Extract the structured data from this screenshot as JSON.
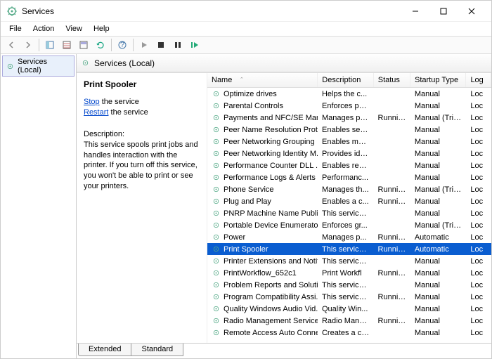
{
  "window": {
    "title": "Services"
  },
  "menu": [
    "File",
    "Action",
    "View",
    "Help"
  ],
  "left": {
    "item": "Services (Local)"
  },
  "listHeader": "Services (Local)",
  "details": {
    "selected": "Print Spooler",
    "stop": "Stop",
    "stop_suffix": " the service",
    "restart": "Restart",
    "restart_suffix": " the service",
    "desc_label": "Description:",
    "desc": "This service spools print jobs and handles interaction with the printer. If you turn off this service, you won't be able to print or see your printers."
  },
  "cols": {
    "name": "Name",
    "desc": "Description",
    "status": "Status",
    "startup": "Startup Type",
    "logon": "Log"
  },
  "rows": [
    {
      "name": "Optimize drives",
      "desc": "Helps the c...",
      "status": "",
      "startup": "Manual",
      "logon": "Loc"
    },
    {
      "name": "Parental Controls",
      "desc": "Enforces pa...",
      "status": "",
      "startup": "Manual",
      "logon": "Loc"
    },
    {
      "name": "Payments and NFC/SE Man...",
      "desc": "Manages pa...",
      "status": "Running",
      "startup": "Manual (Trig...",
      "logon": "Loc"
    },
    {
      "name": "Peer Name Resolution Prot...",
      "desc": "Enables serv...",
      "status": "",
      "startup": "Manual",
      "logon": "Loc"
    },
    {
      "name": "Peer Networking Grouping",
      "desc": "Enables mul...",
      "status": "",
      "startup": "Manual",
      "logon": "Loc"
    },
    {
      "name": "Peer Networking Identity M...",
      "desc": "Provides ide...",
      "status": "",
      "startup": "Manual",
      "logon": "Loc"
    },
    {
      "name": "Performance Counter DLL ...",
      "desc": "Enables rem...",
      "status": "",
      "startup": "Manual",
      "logon": "Loc"
    },
    {
      "name": "Performance Logs & Alerts",
      "desc": "Performanc...",
      "status": "",
      "startup": "Manual",
      "logon": "Loc"
    },
    {
      "name": "Phone Service",
      "desc": "Manages th...",
      "status": "Running",
      "startup": "Manual (Trig...",
      "logon": "Loc"
    },
    {
      "name": "Plug and Play",
      "desc": "Enables a c...",
      "status": "Running",
      "startup": "Manual",
      "logon": "Loc"
    },
    {
      "name": "PNRP Machine Name Publi...",
      "desc": "This service ...",
      "status": "",
      "startup": "Manual",
      "logon": "Loc"
    },
    {
      "name": "Portable Device Enumerator...",
      "desc": "Enforces gr...",
      "status": "",
      "startup": "Manual (Trig...",
      "logon": "Loc"
    },
    {
      "name": "Power",
      "desc": "Manages p...",
      "status": "Running",
      "startup": "Automatic",
      "logon": "Loc"
    },
    {
      "name": "Print Spooler",
      "desc": "This service ...",
      "status": "Running",
      "startup": "Automatic",
      "logon": "Loc",
      "selected": true
    },
    {
      "name": "Printer Extensions and Notif...",
      "desc": "This service ...",
      "status": "",
      "startup": "Manual",
      "logon": "Loc"
    },
    {
      "name": "PrintWorkflow_652c1",
      "desc": "Print Workfl",
      "status": "Running",
      "startup": "Manual",
      "logon": "Loc"
    },
    {
      "name": "Problem Reports and Soluti...",
      "desc": "This service ...",
      "status": "",
      "startup": "Manual",
      "logon": "Loc"
    },
    {
      "name": "Program Compatibility Assi...",
      "desc": "This service ...",
      "status": "Running",
      "startup": "Manual",
      "logon": "Loc"
    },
    {
      "name": "Quality Windows Audio Vid...",
      "desc": "Quality Win...",
      "status": "",
      "startup": "Manual",
      "logon": "Loc"
    },
    {
      "name": "Radio Management Service",
      "desc": "Radio Mana...",
      "status": "Running",
      "startup": "Manual",
      "logon": "Loc"
    },
    {
      "name": "Remote Access Auto Conne...",
      "desc": "Creates a co...",
      "status": "",
      "startup": "Manual",
      "logon": "Loc"
    }
  ],
  "tabs": [
    "Extended",
    "Standard"
  ]
}
